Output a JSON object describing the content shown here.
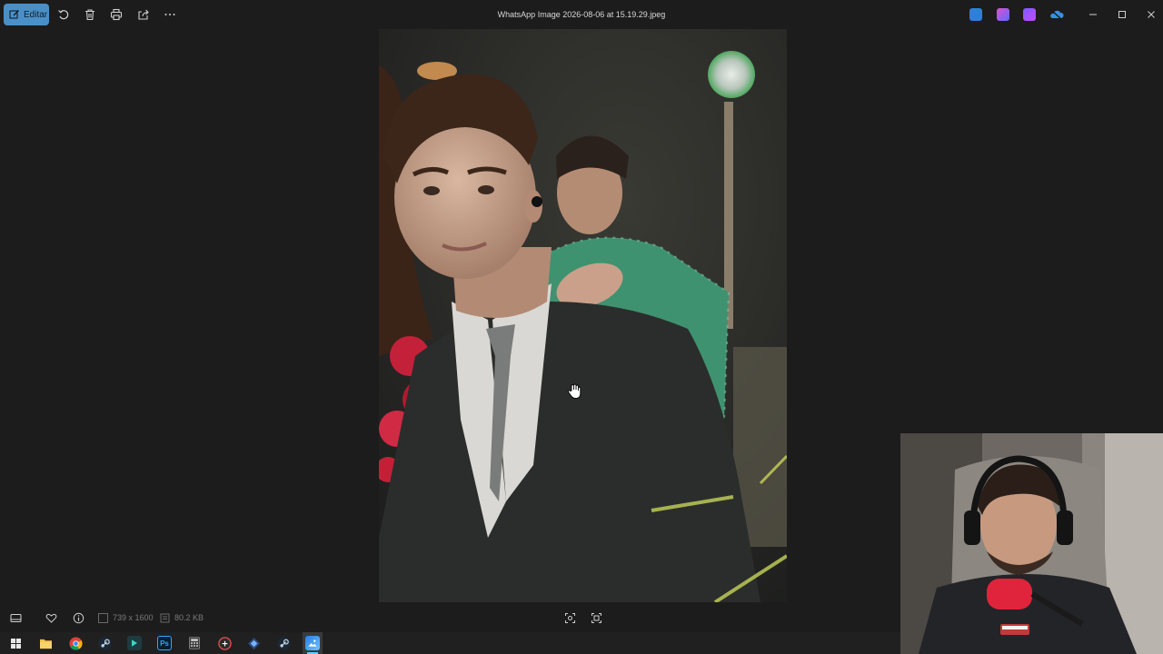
{
  "toolbar": {
    "edit_label": "Editar",
    "title": "WhatsApp Image 2026-08-06 at 15.19.29.jpeg",
    "icons": [
      "pencil-icon",
      "rotate-icon",
      "trash-icon",
      "print-icon",
      "share-icon",
      "more-icon"
    ],
    "tray_icons": [
      "app-tray-icon",
      "app-tray-icon",
      "app-tray-icon",
      "onedrive-icon"
    ],
    "window_controls": [
      "minimize-icon",
      "maximize-icon",
      "close-icon"
    ]
  },
  "status": {
    "dimensions": "739 x 1600",
    "file_size": "80.2 KB"
  },
  "colors": {
    "accent": "#4a90c8",
    "background": "#1c1c1c",
    "taskbar": "#202020",
    "taskbar_active_indicator": "#60cdff"
  },
  "taskbar": {
    "icons": [
      "windows-start-icon",
      "file-explorer-icon",
      "chrome-icon",
      "steam-icon",
      "app-icon",
      "photoshop-icon",
      "calculator-icon",
      "app-icon",
      "app-icon",
      "steam-icon",
      "photos-app-icon"
    ],
    "photoshop_label": "Ps"
  }
}
